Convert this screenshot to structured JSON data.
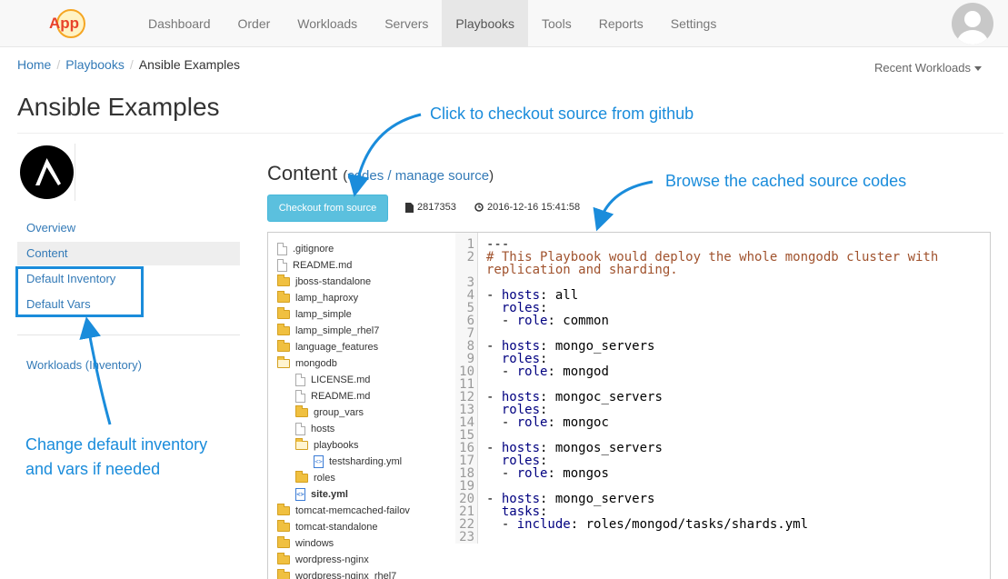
{
  "nav": {
    "logo_text": "App",
    "items": [
      {
        "label": "Dashboard",
        "active": false
      },
      {
        "label": "Order",
        "active": false
      },
      {
        "label": "Workloads",
        "active": false
      },
      {
        "label": "Servers",
        "active": false
      },
      {
        "label": "Playbooks",
        "active": true
      },
      {
        "label": "Tools",
        "active": false
      },
      {
        "label": "Reports",
        "active": false
      },
      {
        "label": "Settings",
        "active": false
      }
    ],
    "avatar_icon": "user-avatar-icon"
  },
  "breadcrumb": {
    "home": "Home",
    "playbooks": "Playbooks",
    "current": "Ansible Examples",
    "separator": "/"
  },
  "recent_workloads": "Recent Workloads",
  "page_title": "Ansible Examples",
  "sidebar": {
    "items": [
      {
        "label": "Overview",
        "active": false
      },
      {
        "label": "Content",
        "active": true
      },
      {
        "label": "Default Inventory",
        "active": false
      },
      {
        "label": "Default Vars",
        "active": false
      },
      {
        "label": "Workloads (Inventory)",
        "active": false
      }
    ]
  },
  "content": {
    "title": "Content",
    "paren_open": "(",
    "link_codes": "codes",
    "link_sep": " / ",
    "link_manage": "manage source",
    "paren_close": ")",
    "checkout_button": "Checkout from source",
    "file_size": "2817353",
    "timestamp": "2016-12-16 15:41:58"
  },
  "file_tree": [
    {
      "name": ".gitignore",
      "type": "file",
      "depth": 0
    },
    {
      "name": "README.md",
      "type": "file",
      "depth": 0
    },
    {
      "name": "jboss-standalone",
      "type": "folder",
      "depth": 0
    },
    {
      "name": "lamp_haproxy",
      "type": "folder",
      "depth": 0
    },
    {
      "name": "lamp_simple",
      "type": "folder",
      "depth": 0
    },
    {
      "name": "lamp_simple_rhel7",
      "type": "folder",
      "depth": 0
    },
    {
      "name": "language_features",
      "type": "folder",
      "depth": 0
    },
    {
      "name": "mongodb",
      "type": "folder-open",
      "depth": 0
    },
    {
      "name": "LICENSE.md",
      "type": "file",
      "depth": 1
    },
    {
      "name": "README.md",
      "type": "file",
      "depth": 1
    },
    {
      "name": "group_vars",
      "type": "folder",
      "depth": 1
    },
    {
      "name": "hosts",
      "type": "file",
      "depth": 1
    },
    {
      "name": "playbooks",
      "type": "folder-open",
      "depth": 1
    },
    {
      "name": "testsharding.yml",
      "type": "code",
      "depth": 2
    },
    {
      "name": "roles",
      "type": "folder",
      "depth": 1
    },
    {
      "name": "site.yml",
      "type": "code",
      "depth": 1,
      "bold": true
    },
    {
      "name": "tomcat-memcached-failov",
      "type": "folder",
      "depth": 0
    },
    {
      "name": "tomcat-standalone",
      "type": "folder",
      "depth": 0
    },
    {
      "name": "windows",
      "type": "folder",
      "depth": 0
    },
    {
      "name": "wordpress-nginx",
      "type": "folder",
      "depth": 0
    },
    {
      "name": "wordpress-nginx_rhel7",
      "type": "folder",
      "depth": 0
    }
  ],
  "code_lines": [
    {
      "n": "1",
      "parts": [
        [
          "plain",
          "---"
        ]
      ]
    },
    {
      "n": "2",
      "parts": [
        [
          "comment",
          "# This Playbook would deploy the whole mongodb cluster with"
        ]
      ]
    },
    {
      "n": "",
      "parts": [
        [
          "comment",
          "replication and sharding."
        ]
      ]
    },
    {
      "n": "3",
      "parts": []
    },
    {
      "n": "4",
      "parts": [
        [
          "plain",
          "- "
        ],
        [
          "key",
          "hosts"
        ],
        [
          "plain",
          ": all"
        ]
      ]
    },
    {
      "n": "5",
      "parts": [
        [
          "plain",
          "  "
        ],
        [
          "key",
          "roles"
        ],
        [
          "plain",
          ":"
        ]
      ]
    },
    {
      "n": "6",
      "parts": [
        [
          "plain",
          "  - "
        ],
        [
          "key",
          "role"
        ],
        [
          "plain",
          ": common"
        ]
      ]
    },
    {
      "n": "7",
      "parts": []
    },
    {
      "n": "8",
      "parts": [
        [
          "plain",
          "- "
        ],
        [
          "key",
          "hosts"
        ],
        [
          "plain",
          ": mongo_servers"
        ]
      ]
    },
    {
      "n": "9",
      "parts": [
        [
          "plain",
          "  "
        ],
        [
          "key",
          "roles"
        ],
        [
          "plain",
          ":"
        ]
      ]
    },
    {
      "n": "10",
      "parts": [
        [
          "plain",
          "  - "
        ],
        [
          "key",
          "role"
        ],
        [
          "plain",
          ": mongod"
        ]
      ]
    },
    {
      "n": "11",
      "parts": []
    },
    {
      "n": "12",
      "parts": [
        [
          "plain",
          "- "
        ],
        [
          "key",
          "hosts"
        ],
        [
          "plain",
          ": mongoc_servers"
        ]
      ]
    },
    {
      "n": "13",
      "parts": [
        [
          "plain",
          "  "
        ],
        [
          "key",
          "roles"
        ],
        [
          "plain",
          ":"
        ]
      ]
    },
    {
      "n": "14",
      "parts": [
        [
          "plain",
          "  - "
        ],
        [
          "key",
          "role"
        ],
        [
          "plain",
          ": mongoc"
        ]
      ]
    },
    {
      "n": "15",
      "parts": []
    },
    {
      "n": "16",
      "parts": [
        [
          "plain",
          "- "
        ],
        [
          "key",
          "hosts"
        ],
        [
          "plain",
          ": mongos_servers"
        ]
      ]
    },
    {
      "n": "17",
      "parts": [
        [
          "plain",
          "  "
        ],
        [
          "key",
          "roles"
        ],
        [
          "plain",
          ":"
        ]
      ]
    },
    {
      "n": "18",
      "parts": [
        [
          "plain",
          "  - "
        ],
        [
          "key",
          "role"
        ],
        [
          "plain",
          ": mongos"
        ]
      ]
    },
    {
      "n": "19",
      "parts": []
    },
    {
      "n": "20",
      "parts": [
        [
          "plain",
          "- "
        ],
        [
          "key",
          "hosts"
        ],
        [
          "plain",
          ": mongo_servers"
        ]
      ]
    },
    {
      "n": "21",
      "parts": [
        [
          "plain",
          "  "
        ],
        [
          "key",
          "tasks"
        ],
        [
          "plain",
          ":"
        ]
      ]
    },
    {
      "n": "22",
      "parts": [
        [
          "plain",
          "  - "
        ],
        [
          "key",
          "include"
        ],
        [
          "plain",
          ": roles/mongod/tasks/shards.yml"
        ]
      ]
    },
    {
      "n": "23",
      "parts": []
    }
  ],
  "annotations": {
    "checkout": "Click to checkout source from github",
    "browse": "Browse the cached source codes",
    "inventory_line1": "Change default inventory",
    "inventory_line2": "and vars if needed",
    "color": "#1a8cdb"
  }
}
